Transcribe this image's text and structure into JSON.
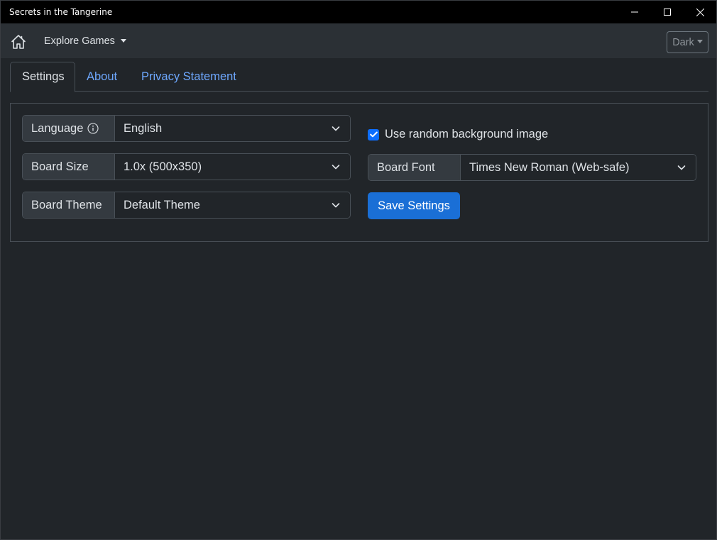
{
  "window": {
    "title": "Secrets in the Tangerine"
  },
  "navbar": {
    "explore_label": "Explore Games",
    "theme_label": "Dark"
  },
  "tabs": [
    {
      "label": "Settings",
      "active": true
    },
    {
      "label": "About",
      "active": false
    },
    {
      "label": "Privacy Statement",
      "active": false
    }
  ],
  "settings": {
    "language": {
      "label": "Language",
      "value": "English"
    },
    "board_size": {
      "label": "Board Size",
      "value": "1.0x (500x350)"
    },
    "board_theme": {
      "label": "Board Theme",
      "value": "Default Theme"
    },
    "random_bg": {
      "label": "Use random background image",
      "checked": true
    },
    "board_font": {
      "label": "Board Font",
      "value": "Times New Roman (Web-safe)"
    },
    "save_label": "Save Settings"
  },
  "colors": {
    "background": "#212529",
    "navbar": "#2b3035",
    "link": "#6ea8fe",
    "primary": "#1a6fd6"
  }
}
